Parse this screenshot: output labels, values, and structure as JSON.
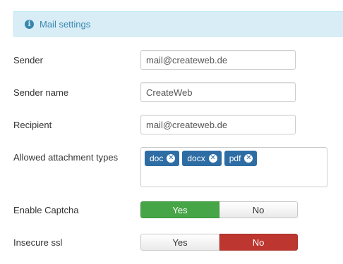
{
  "panel": {
    "title": "Mail settings",
    "icon": "info-icon",
    "accent_color": "#3a87ad"
  },
  "fields": {
    "sender": {
      "label": "Sender",
      "value": "mail@createweb.de"
    },
    "sender_name": {
      "label": "Sender name",
      "value": "CreateWeb"
    },
    "recipient": {
      "label": "Recipient",
      "value": "mail@createweb.de"
    },
    "attachments": {
      "label": "Allowed attachment types",
      "tags": [
        "doc",
        "docx",
        "pdf"
      ],
      "remove_icon": "close-circle-icon"
    },
    "captcha": {
      "label": "Enable Captcha",
      "yes": "Yes",
      "no": "No",
      "selected": "Yes",
      "selected_color": "#46a546"
    },
    "insecure_ssl": {
      "label": "Insecure ssl",
      "yes": "Yes",
      "no": "No",
      "selected": "No",
      "selected_color": "#bd362f"
    }
  }
}
